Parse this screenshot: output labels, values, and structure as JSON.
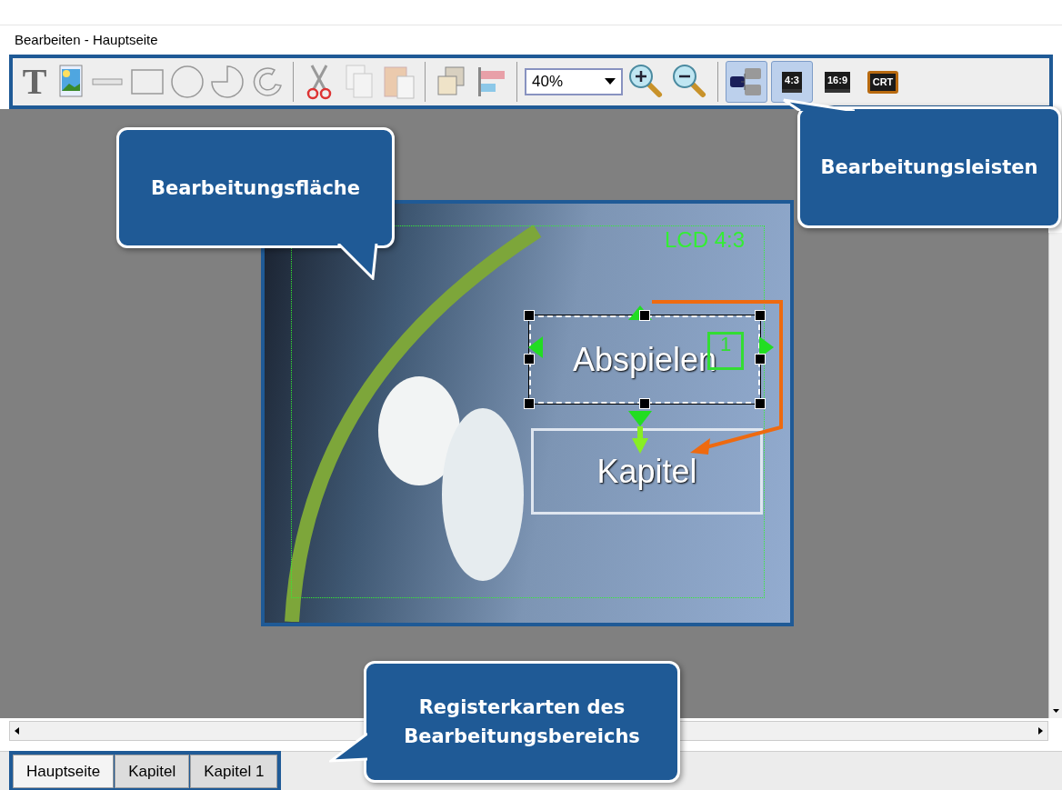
{
  "window": {
    "title": "Bearbeiten - Hauptseite"
  },
  "toolbar": {
    "text_tool": "T",
    "edit_tools": [
      {
        "disabled": false
      },
      {
        "disabled": true
      },
      {
        "disabled": true
      }
    ],
    "zoom": {
      "value": "40%"
    },
    "layout_view": {
      "selected": true
    },
    "screen_modes": [
      {
        "label": "4:3",
        "selected": true
      },
      {
        "label": "16:9",
        "selected": false
      },
      {
        "label": "CRT",
        "selected": false
      }
    ]
  },
  "canvas": {
    "safe_area_label": "LCD 4:3",
    "menu_buttons": [
      {
        "label": "Abspielen",
        "selected": true,
        "number": "1"
      },
      {
        "label": "Kapitel",
        "selected": false
      }
    ]
  },
  "callouts": [
    {
      "text": "Bearbeitungsfläche"
    },
    {
      "text": "Bearbeitungsleisten"
    },
    {
      "text": "Registerkarten des Bearbeitungsbereichs"
    }
  ],
  "tabs": [
    {
      "label": "Hauptseite",
      "selected": true
    },
    {
      "label": "Kapitel",
      "selected": false
    },
    {
      "label": "Kapitel 1",
      "selected": false
    }
  ]
}
